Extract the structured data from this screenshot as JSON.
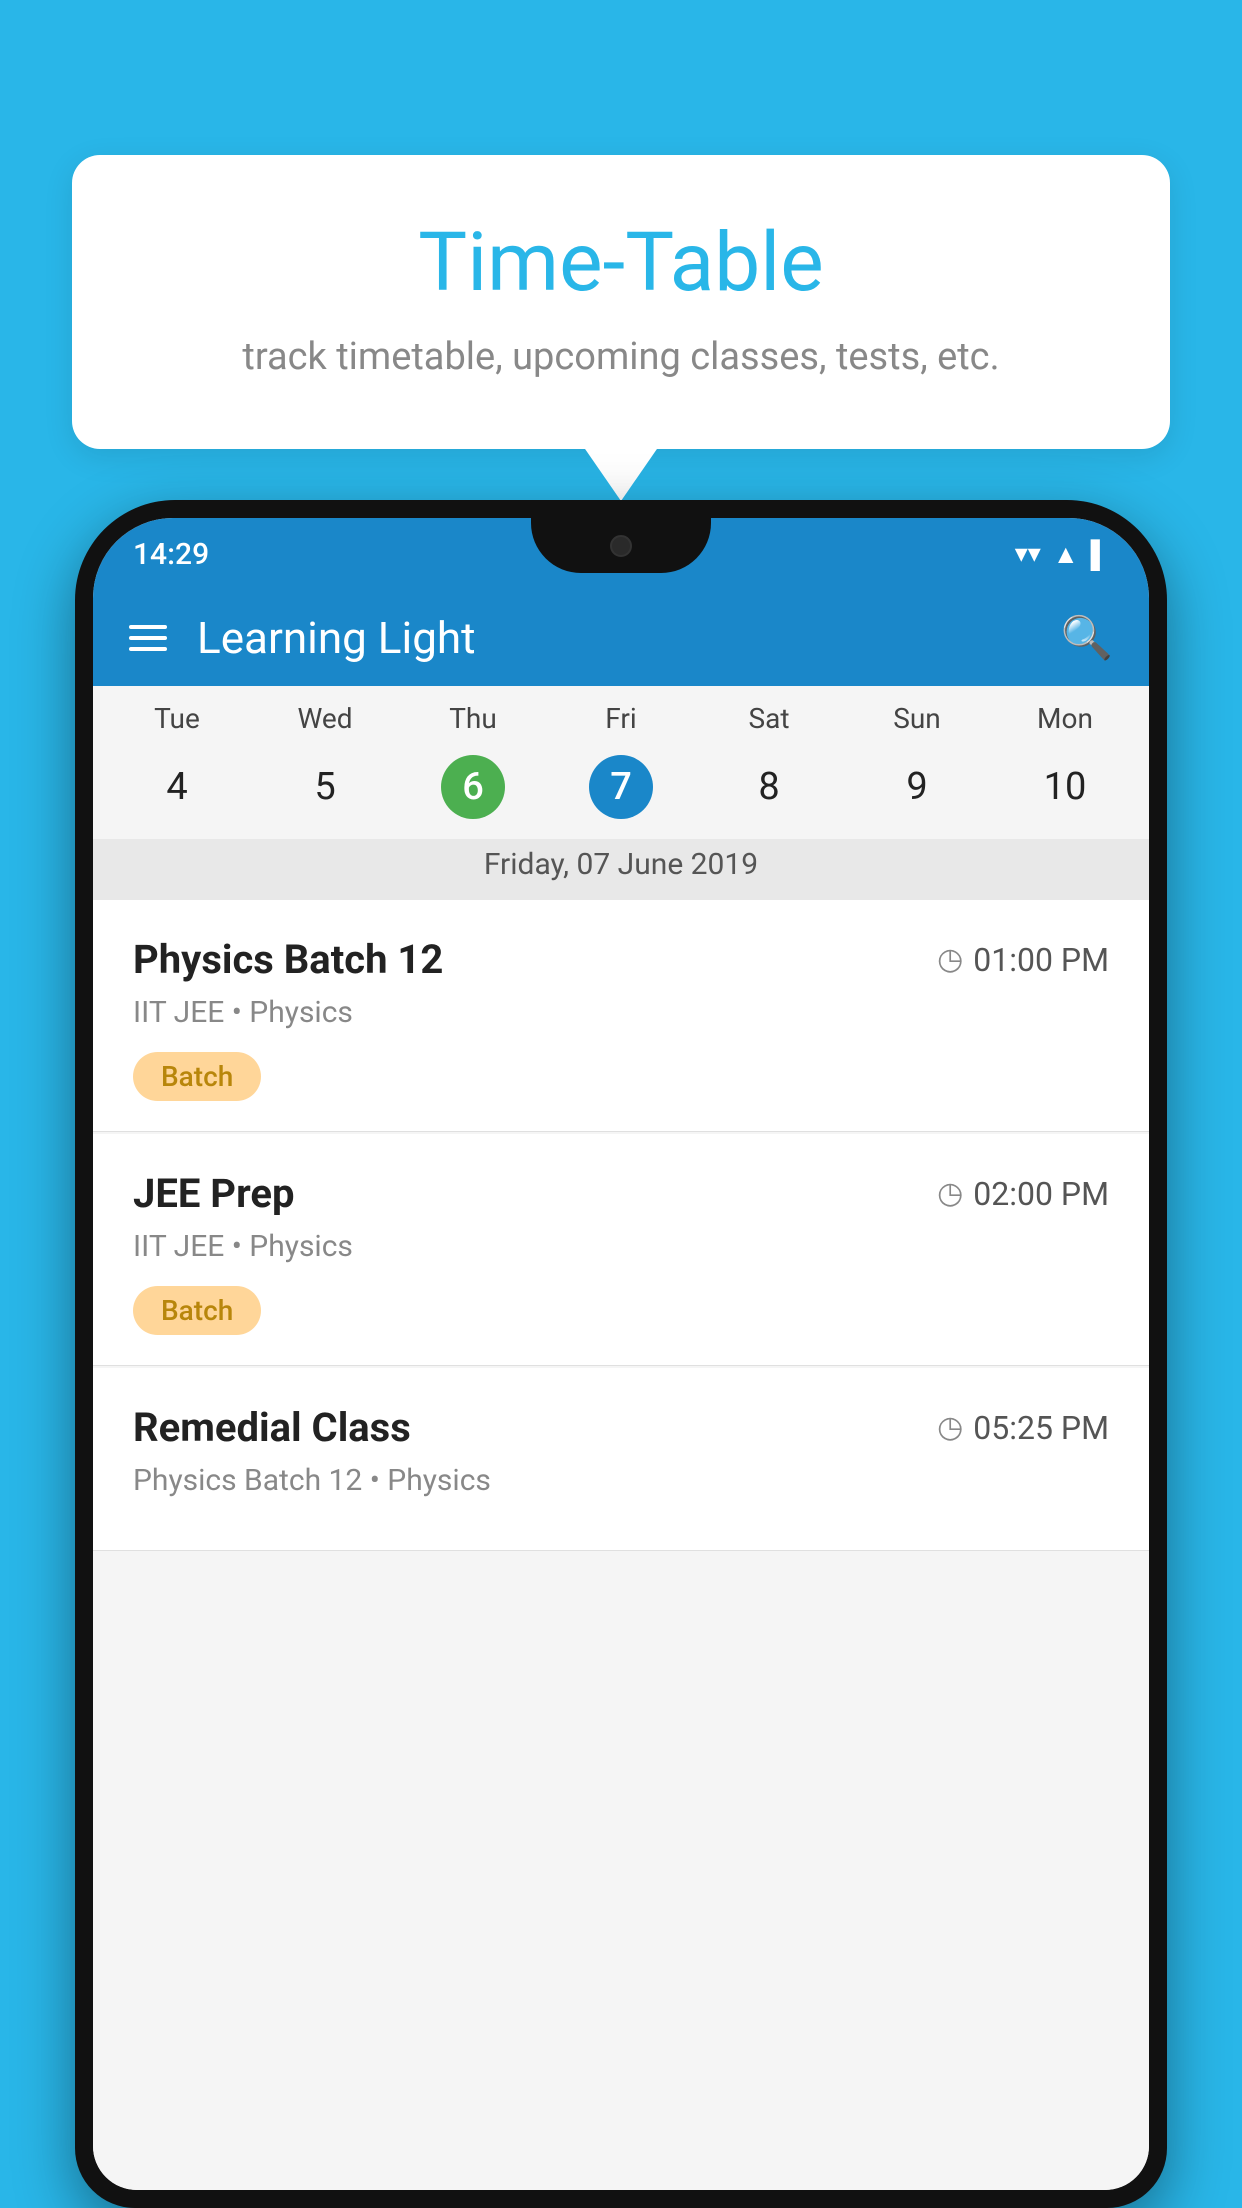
{
  "background_color": "#29b6e8",
  "bubble": {
    "title": "Time-Table",
    "subtitle": "track timetable, upcoming classes, tests, etc."
  },
  "status_bar": {
    "time": "14:29",
    "wifi": "▼",
    "signal": "▲",
    "battery": "▐"
  },
  "app_header": {
    "title": "Learning Light",
    "menu_icon": "menu",
    "search_icon": "search"
  },
  "calendar": {
    "days": [
      "Tue",
      "Wed",
      "Thu",
      "Fri",
      "Sat",
      "Sun",
      "Mon"
    ],
    "dates": [
      {
        "num": "4",
        "state": "normal"
      },
      {
        "num": "5",
        "state": "normal"
      },
      {
        "num": "6",
        "state": "today"
      },
      {
        "num": "7",
        "state": "selected"
      },
      {
        "num": "8",
        "state": "normal"
      },
      {
        "num": "9",
        "state": "normal"
      },
      {
        "num": "10",
        "state": "normal"
      }
    ],
    "selected_date_label": "Friday, 07 June 2019"
  },
  "schedule": [
    {
      "title": "Physics Batch 12",
      "time": "01:00 PM",
      "subtitle": "IIT JEE • Physics",
      "tag": "Batch"
    },
    {
      "title": "JEE Prep",
      "time": "02:00 PM",
      "subtitle": "IIT JEE • Physics",
      "tag": "Batch"
    },
    {
      "title": "Remedial Class",
      "time": "05:25 PM",
      "subtitle": "Physics Batch 12 • Physics",
      "tag": ""
    }
  ]
}
